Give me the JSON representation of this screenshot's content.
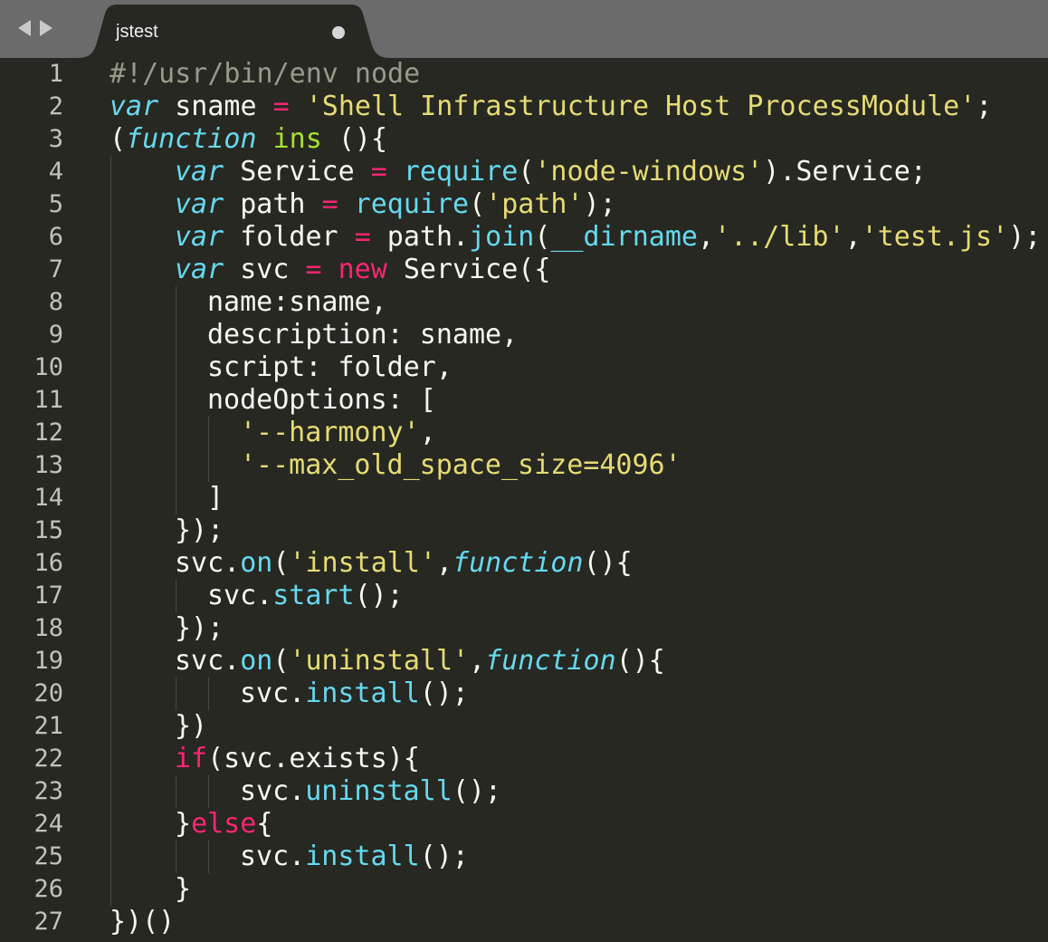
{
  "tab": {
    "title": "jstest",
    "modified": true
  },
  "nav": {
    "back_icon": "triangle-left-icon",
    "forward_icon": "triangle-right-icon"
  },
  "colors": {
    "background": "#272822",
    "tabbar": "#6b6b6b",
    "keyword": "#66d9ef",
    "string": "#e6db74",
    "operator": "#f92672",
    "function_name": "#a6e22e",
    "comment": "#9a998a",
    "text": "#f8f8f2"
  },
  "lines": [
    {
      "num": "1",
      "indent": 0,
      "tokens": [
        {
          "t": "#!/usr/bin/env node",
          "c": "c"
        }
      ]
    },
    {
      "num": "2",
      "indent": 0,
      "tokens": [
        {
          "t": "var",
          "c": "k"
        },
        {
          "t": " sname ",
          "c": "p"
        },
        {
          "t": "=",
          "c": "o"
        },
        {
          "t": " ",
          "c": "p"
        },
        {
          "t": "'Shell Infrastructure Host ProcessModule'",
          "c": "s"
        },
        {
          "t": ";",
          "c": "p"
        }
      ]
    },
    {
      "num": "3",
      "indent": 0,
      "tokens": [
        {
          "t": "(",
          "c": "p"
        },
        {
          "t": "function",
          "c": "k"
        },
        {
          "t": " ",
          "c": "p"
        },
        {
          "t": "ins",
          "c": "g"
        },
        {
          "t": " (){",
          "c": "p"
        }
      ]
    },
    {
      "num": "4",
      "indent": 1,
      "tokens": [
        {
          "t": "var",
          "c": "k"
        },
        {
          "t": " Service ",
          "c": "p"
        },
        {
          "t": "=",
          "c": "o"
        },
        {
          "t": " ",
          "c": "p"
        },
        {
          "t": "require",
          "c": "f"
        },
        {
          "t": "(",
          "c": "p"
        },
        {
          "t": "'node-windows'",
          "c": "s"
        },
        {
          "t": ").Service;",
          "c": "p"
        }
      ]
    },
    {
      "num": "5",
      "indent": 1,
      "tokens": [
        {
          "t": "var",
          "c": "k"
        },
        {
          "t": " path ",
          "c": "p"
        },
        {
          "t": "=",
          "c": "o"
        },
        {
          "t": " ",
          "c": "p"
        },
        {
          "t": "require",
          "c": "f"
        },
        {
          "t": "(",
          "c": "p"
        },
        {
          "t": "'path'",
          "c": "s"
        },
        {
          "t": ");",
          "c": "p"
        }
      ]
    },
    {
      "num": "6",
      "indent": 1,
      "tokens": [
        {
          "t": "var",
          "c": "k"
        },
        {
          "t": " folder ",
          "c": "p"
        },
        {
          "t": "=",
          "c": "o"
        },
        {
          "t": " path.",
          "c": "p"
        },
        {
          "t": "join",
          "c": "f"
        },
        {
          "t": "(",
          "c": "p"
        },
        {
          "t": "__dirname",
          "c": "f"
        },
        {
          "t": ",",
          "c": "p"
        },
        {
          "t": "'../lib'",
          "c": "s"
        },
        {
          "t": ",",
          "c": "p"
        },
        {
          "t": "'test.js'",
          "c": "s"
        },
        {
          "t": ");",
          "c": "p"
        }
      ]
    },
    {
      "num": "7",
      "indent": 1,
      "tokens": [
        {
          "t": "var",
          "c": "k"
        },
        {
          "t": " svc ",
          "c": "p"
        },
        {
          "t": "=",
          "c": "o"
        },
        {
          "t": " ",
          "c": "p"
        },
        {
          "t": "new",
          "c": "o"
        },
        {
          "t": " Service({",
          "c": "p"
        }
      ]
    },
    {
      "num": "8",
      "indent": 2,
      "tokens": [
        {
          "t": "name:sname,",
          "c": "p"
        }
      ]
    },
    {
      "num": "9",
      "indent": 2,
      "tokens": [
        {
          "t": "description: sname,",
          "c": "p"
        }
      ]
    },
    {
      "num": "10",
      "indent": 2,
      "tokens": [
        {
          "t": "script: folder,",
          "c": "p"
        }
      ]
    },
    {
      "num": "11",
      "indent": 2,
      "tokens": [
        {
          "t": "nodeOptions: [",
          "c": "p"
        }
      ]
    },
    {
      "num": "12",
      "indent": 3,
      "tokens": [
        {
          "t": "'--harmony'",
          "c": "s"
        },
        {
          "t": ",",
          "c": "p"
        }
      ]
    },
    {
      "num": "13",
      "indent": 3,
      "tokens": [
        {
          "t": "'--max_old_space_size=4096'",
          "c": "s"
        }
      ]
    },
    {
      "num": "14",
      "indent": 2,
      "tokens": [
        {
          "t": "]",
          "c": "p"
        }
      ]
    },
    {
      "num": "15",
      "indent": 1,
      "tokens": [
        {
          "t": "});",
          "c": "p"
        }
      ]
    },
    {
      "num": "16",
      "indent": 1,
      "tokens": [
        {
          "t": "svc.",
          "c": "p"
        },
        {
          "t": "on",
          "c": "f"
        },
        {
          "t": "(",
          "c": "p"
        },
        {
          "t": "'install'",
          "c": "s"
        },
        {
          "t": ",",
          "c": "p"
        },
        {
          "t": "function",
          "c": "k"
        },
        {
          "t": "(){",
          "c": "p"
        }
      ]
    },
    {
      "num": "17",
      "indent": 2,
      "tokens": [
        {
          "t": "svc.",
          "c": "p"
        },
        {
          "t": "start",
          "c": "f"
        },
        {
          "t": "();",
          "c": "p"
        }
      ]
    },
    {
      "num": "18",
      "indent": 1,
      "tokens": [
        {
          "t": "});",
          "c": "p"
        }
      ]
    },
    {
      "num": "19",
      "indent": 1,
      "tokens": [
        {
          "t": "svc.",
          "c": "p"
        },
        {
          "t": "on",
          "c": "f"
        },
        {
          "t": "(",
          "c": "p"
        },
        {
          "t": "'uninstall'",
          "c": "s"
        },
        {
          "t": ",",
          "c": "p"
        },
        {
          "t": "function",
          "c": "k"
        },
        {
          "t": "(){",
          "c": "p"
        }
      ]
    },
    {
      "num": "20",
      "indent": 3,
      "tokens": [
        {
          "t": "svc.",
          "c": "p"
        },
        {
          "t": "install",
          "c": "f"
        },
        {
          "t": "();",
          "c": "p"
        }
      ]
    },
    {
      "num": "21",
      "indent": 1,
      "tokens": [
        {
          "t": "})",
          "c": "p"
        }
      ]
    },
    {
      "num": "22",
      "indent": 1,
      "tokens": [
        {
          "t": "if",
          "c": "o"
        },
        {
          "t": "(svc.exists){",
          "c": "p"
        }
      ]
    },
    {
      "num": "23",
      "indent": 3,
      "tokens": [
        {
          "t": "svc.",
          "c": "p"
        },
        {
          "t": "uninstall",
          "c": "f"
        },
        {
          "t": "();",
          "c": "p"
        }
      ]
    },
    {
      "num": "24",
      "indent": 1,
      "tokens": [
        {
          "t": "}",
          "c": "p"
        },
        {
          "t": "else",
          "c": "o"
        },
        {
          "t": "{",
          "c": "p"
        }
      ]
    },
    {
      "num": "25",
      "indent": 3,
      "tokens": [
        {
          "t": "svc.",
          "c": "p"
        },
        {
          "t": "install",
          "c": "f"
        },
        {
          "t": "();",
          "c": "p"
        }
      ]
    },
    {
      "num": "26",
      "indent": 1,
      "tokens": [
        {
          "t": "}",
          "c": "p"
        }
      ]
    },
    {
      "num": "27",
      "indent": 0,
      "tokens": [
        {
          "t": "})()",
          "c": "p"
        }
      ]
    }
  ]
}
